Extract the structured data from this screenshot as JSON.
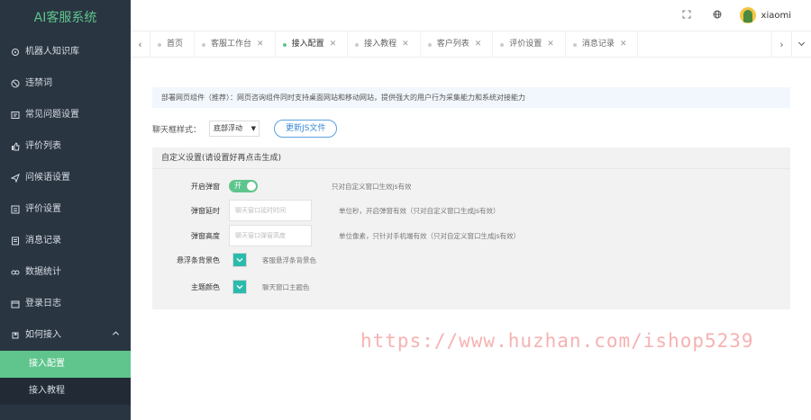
{
  "app": {
    "title": "AI客服系统"
  },
  "sidebar": {
    "items": [
      {
        "label": "机器人知识库",
        "icon": "robot-icon"
      },
      {
        "label": "违禁词",
        "icon": "ban-icon"
      },
      {
        "label": "常见问题设置",
        "icon": "faq-icon"
      },
      {
        "label": "评价列表",
        "icon": "thumb-icon"
      },
      {
        "label": "问候语设置",
        "icon": "send-icon"
      },
      {
        "label": "评价设置",
        "icon": "list-icon"
      },
      {
        "label": "消息记录",
        "icon": "message-icon"
      },
      {
        "label": "数据统计",
        "icon": "chart-icon"
      },
      {
        "label": "登录日志",
        "icon": "log-icon"
      },
      {
        "label": "如何接入",
        "icon": "plug-icon"
      }
    ],
    "sub_items": [
      {
        "label": "接入配置",
        "active": true
      },
      {
        "label": "接入教程",
        "active": false
      }
    ]
  },
  "header": {
    "username": "xiaomi"
  },
  "tabs": [
    {
      "label": "首页",
      "closable": false,
      "active": false
    },
    {
      "label": "客服工作台",
      "closable": true,
      "active": false
    },
    {
      "label": "接入配置",
      "closable": true,
      "active": true
    },
    {
      "label": "接入教程",
      "closable": true,
      "active": false
    },
    {
      "label": "客户列表",
      "closable": true,
      "active": false
    },
    {
      "label": "评价设置",
      "closable": true,
      "active": false
    },
    {
      "label": "消息记录",
      "closable": true,
      "active": false
    }
  ],
  "notice": "部署网页组件（推荐）：网页咨询组件同时支持桌面网站和移动网站，提供强大的用户行为采集能力和系统对接能力",
  "chat_style": {
    "label": "聊天框样式：",
    "selected": "底部浮动",
    "update_button": "更新JS文件"
  },
  "custom_panel": {
    "title": "自定义设置(请设置好再点击生成)",
    "popup_switch": {
      "label": "开启弹窗",
      "value": "开",
      "hint": "只对自定义窗口生效js有效"
    },
    "popup_delay": {
      "label": "弹窗延时",
      "placeholder": "聊天窗口延时时间",
      "hint": "单位秒，开启弹窗有效（只对自定义窗口生成js有效）"
    },
    "popup_height": {
      "label": "弹窗高度",
      "placeholder": "聊天窗口弹窗高度",
      "hint": "单位像素，只针对手机端有效（只对自定义窗口生成js有效）"
    },
    "float_bg": {
      "label": "悬浮条背景色",
      "hint": "客服悬浮条背景色",
      "color": "#2bbbad"
    },
    "theme_color": {
      "label": "主题颜色",
      "hint": "聊天窗口主题色",
      "color": "#2bbbad"
    }
  },
  "watermark": "https://www.huzhan.com/ishop5239",
  "colors": {
    "accent": "#5fc58d",
    "sidebar_bg": "#2a3542",
    "swatch": "#2bbbad"
  }
}
